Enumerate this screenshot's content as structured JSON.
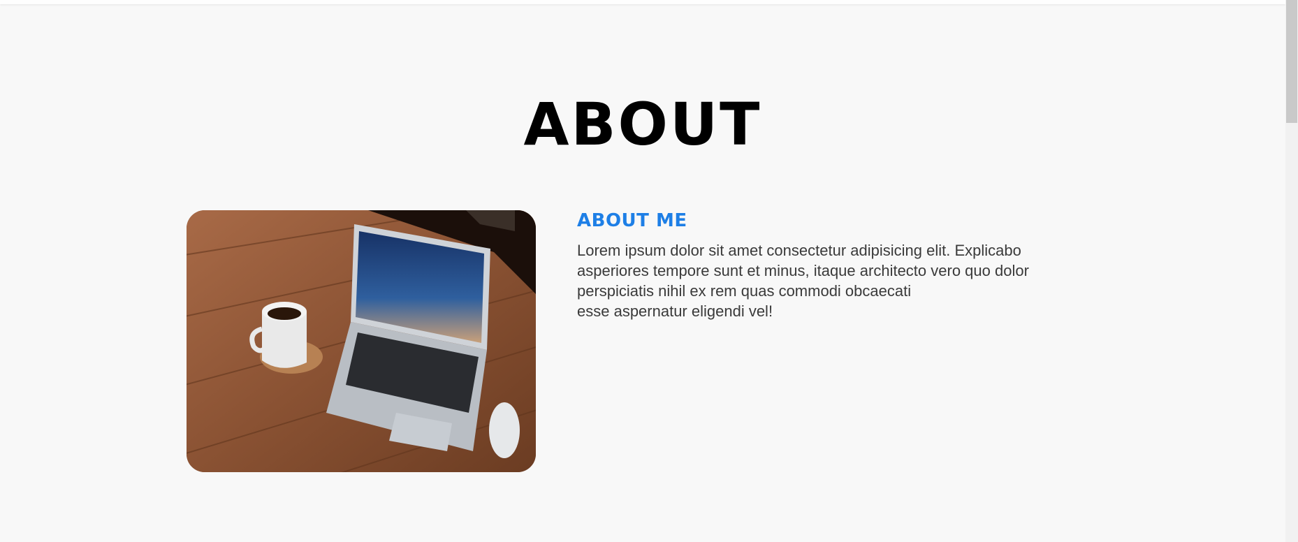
{
  "section": {
    "title": "ABOUT"
  },
  "about": {
    "heading": "ABOUT ME",
    "paragraph_lines": [
      "Lorem ipsum dolor sit amet consectetur adipisicing elit. Explicabo",
      "asperiores tempore sunt et minus, itaque architecto vero quo dolor",
      "perspiciatis nihil ex rem quas commodi obcaecati",
      "esse aspernatur eligendi vel!"
    ]
  },
  "photo": {
    "icon": "laptop-coffee-photo"
  },
  "colors": {
    "accent": "#1e7fe6",
    "background": "#f8f8f8",
    "title": "#000000",
    "body_text": "#3a3a3a"
  }
}
